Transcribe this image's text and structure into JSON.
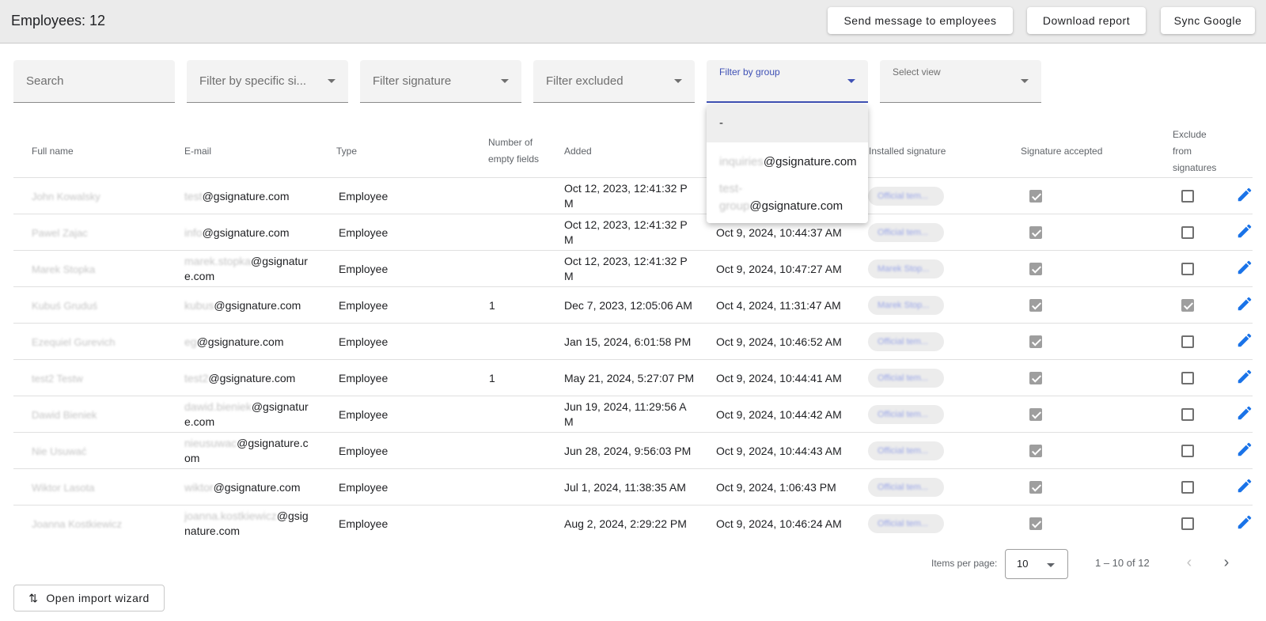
{
  "header": {
    "title": "Employees: 12",
    "buttons": {
      "send_message": "Send message to employees",
      "download_report": "Download report",
      "sync_google": "Sync Google"
    }
  },
  "filters": {
    "search": "Search",
    "specific_signature": "Filter by specific si...",
    "signature": "Filter signature",
    "excluded": "Filter excluded",
    "group": "Filter by group",
    "view": "Select view"
  },
  "group_dropdown": {
    "options": [
      {
        "prefix": "",
        "domain": "-"
      },
      {
        "prefix": "inquiries",
        "domain": "@gsignature.com"
      },
      {
        "prefix_line1": "test-",
        "prefix_line2": "group",
        "domain": "@gsignature.com"
      }
    ]
  },
  "table": {
    "headers": {
      "full_name": "Full name",
      "email": "E-mail",
      "type": "Type",
      "empty_fields_1": "Number of",
      "empty_fields_2": "empty fields",
      "added": "Added",
      "installed_signature": "Installed signature",
      "signature_accepted": "Signature accepted",
      "exclude_1": "Exclude",
      "exclude_2": "from",
      "exclude_3": "signatures"
    },
    "rows": [
      {
        "name": "John Kowalsky",
        "email_user": "test",
        "email_rest": "@gsignature.com",
        "email_rest2": "",
        "type": "Employee",
        "empty": "",
        "added1": "Oct 12, 2023, 12:41:32 P",
        "added2": "M",
        "installed": "",
        "signature": "Official tem...",
        "accepted": true,
        "excluded": false
      },
      {
        "name": "Pawel Zajac",
        "email_user": "info",
        "email_rest": "@gsignature.com",
        "email_rest2": "",
        "type": "Employee",
        "empty": "",
        "added1": "Oct 12, 2023, 12:41:32 P",
        "added2": "M",
        "installed": "Oct 9, 2024, 10:44:37 AM",
        "signature": "Official tem...",
        "accepted": true,
        "excluded": false
      },
      {
        "name": "Marek Stopka",
        "email_user": "marek.stopka",
        "email_rest": "@gsignatur",
        "email_rest2": "e.com",
        "type": "Employee",
        "empty": "",
        "added1": "Oct 12, 2023, 12:41:32 P",
        "added2": "M",
        "installed": "Oct 9, 2024, 10:47:27 AM",
        "signature": "Marek Stop...",
        "accepted": true,
        "excluded": false
      },
      {
        "name": "Kubuś Gruduś",
        "email_user": "kubus",
        "email_rest": "@gsignature.com",
        "email_rest2": "",
        "type": "Employee",
        "empty": "1",
        "added1": "Dec 7, 2023, 12:05:06 AM",
        "added2": "",
        "installed": "Oct 4, 2024, 11:31:47 AM",
        "signature": "Marek Stop...",
        "accepted": true,
        "excluded": true
      },
      {
        "name": "Ezequiel Gurevich",
        "email_user": "eg",
        "email_rest": "@gsignature.com",
        "email_rest2": "",
        "type": "Employee",
        "empty": "",
        "added1": "Jan 15, 2024, 6:01:58 PM",
        "added2": "",
        "installed": "Oct 9, 2024, 10:46:52 AM",
        "signature": "Official tem...",
        "accepted": true,
        "excluded": false
      },
      {
        "name": "test2 Testw",
        "email_user": "test2",
        "email_rest": "@gsignature.com",
        "email_rest2": "",
        "type": "Employee",
        "empty": "1",
        "added1": "May 21, 2024, 5:27:07 PM",
        "added2": "",
        "installed": "Oct 9, 2024, 10:44:41 AM",
        "signature": "Official tem...",
        "accepted": true,
        "excluded": false
      },
      {
        "name": "Dawid Bieniek",
        "email_user": "dawid.bieniek",
        "email_rest": "@gsignatur",
        "email_rest2": "e.com",
        "type": "Employee",
        "empty": "",
        "added1": "Jun 19, 2024, 11:29:56 A",
        "added2": "M",
        "installed": "Oct 9, 2024, 10:44:42 AM",
        "signature": "Official tem...",
        "accepted": true,
        "excluded": false
      },
      {
        "name": "Nie Usuwać",
        "email_user": "nieusuwac",
        "email_rest": "@gsignature.c",
        "email_rest2": "om",
        "type": "Employee",
        "empty": "",
        "added1": "Jun 28, 2024, 9:56:03 PM",
        "added2": "",
        "installed": "Oct 9, 2024, 10:44:43 AM",
        "signature": "Official tem...",
        "accepted": true,
        "excluded": false
      },
      {
        "name": "Wiktor Lasota",
        "email_user": "wiktor",
        "email_rest": "@gsignature.com",
        "email_rest2": "",
        "type": "Employee",
        "empty": "",
        "added1": "Jul 1, 2024, 11:38:35 AM",
        "added2": "",
        "installed": "Oct 9, 2024, 1:06:43 PM",
        "signature": "Official tem...",
        "accepted": true,
        "excluded": false
      },
      {
        "name": "Joanna Kostkiewicz",
        "email_user": "joanna.kostkiewicz",
        "email_rest": "@gsig",
        "email_rest2": "nature.com",
        "type": "Employee",
        "empty": "",
        "added1": "Aug 2, 2024, 2:29:22 PM",
        "added2": "",
        "installed": "Oct 9, 2024, 10:46:24 AM",
        "signature": "Official tem...",
        "accepted": true,
        "excluded": false
      }
    ]
  },
  "pagination": {
    "items_per_page_label": "Items per page:",
    "items_per_page": "10",
    "range": "1 – 10 of 12",
    "prev": "‹",
    "next": "›"
  },
  "import": {
    "icon": "⇅",
    "label": "Open import wizard"
  },
  "colors": {
    "accent": "#3f51b5",
    "edit_icon": "#1a73e8"
  }
}
